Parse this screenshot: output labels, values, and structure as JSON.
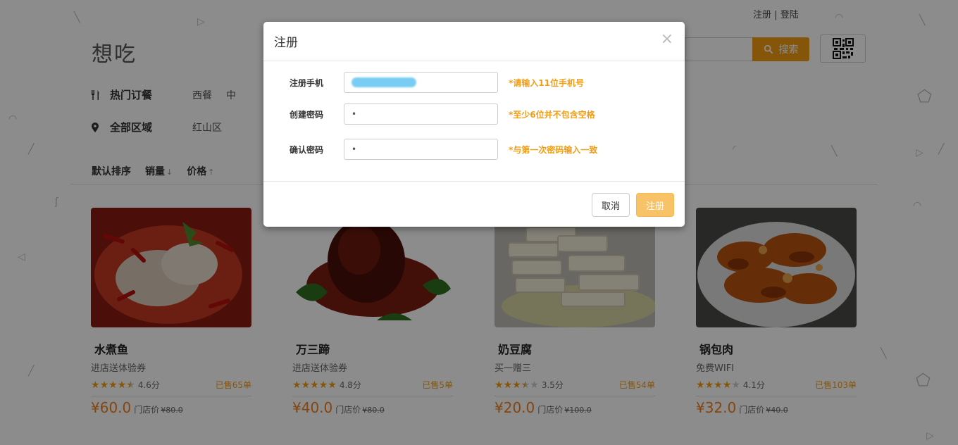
{
  "header": {
    "register_link": "注册",
    "separator": "|",
    "login_link": "登陆",
    "brand": "想吃",
    "search_button": "搜索",
    "search_icon": "search-icon",
    "qr_icon": "qr-code-icon"
  },
  "filters": {
    "hot": {
      "label": "热门订餐",
      "icon": "cutlery-icon",
      "options": [
        "西餐",
        "中"
      ]
    },
    "area": {
      "label": "全部区域",
      "icon": "map-pin-icon",
      "options": [
        "红山区"
      ]
    }
  },
  "sort": {
    "default": "默认排序",
    "sales": "销量",
    "sales_arrow": "↓",
    "price": "价格",
    "price_arrow": "↑"
  },
  "products": [
    {
      "name": "水煮鱼",
      "promo": "进店送体验券",
      "stars": 4.5,
      "score": "4.6分",
      "sold": "已售65单",
      "price": "¥60.0",
      "orig_label": "门店价",
      "orig_price": "¥80.0"
    },
    {
      "name": "万三蹄",
      "promo": "进店送体验券",
      "stars": 5,
      "score": "4.8分",
      "sold": "已售5单",
      "price": "¥40.0",
      "orig_label": "门店价",
      "orig_price": "¥80.0"
    },
    {
      "name": "奶豆腐",
      "promo": "买一赠三",
      "stars": 3.5,
      "score": "3.5分",
      "sold": "已售54单",
      "price": "¥20.0",
      "orig_label": "门店价",
      "orig_price": "¥100.0"
    },
    {
      "name": "锅包肉",
      "promo": "免费WIFI",
      "stars": 4,
      "score": "4.1分",
      "sold": "已售103单",
      "price": "¥32.0",
      "orig_label": "门店价",
      "orig_price": "¥40.0"
    }
  ],
  "modal": {
    "title": "注册",
    "close": "×",
    "fields": [
      {
        "label": "注册手机",
        "value": "",
        "hint": "*请输入11位手机号"
      },
      {
        "label": "创建密码",
        "value": "•",
        "hint": "*至少6位并不包含空格"
      },
      {
        "label": "确认密码",
        "value": "•",
        "hint": "*与第一次密码输入一致"
      }
    ],
    "cancel": "取消",
    "submit": "注册"
  },
  "colors": {
    "accent": "#f39c12",
    "price": "#f08020",
    "submit": "#f7c366",
    "overlay": "rgba(0,0,0,0.45)"
  }
}
